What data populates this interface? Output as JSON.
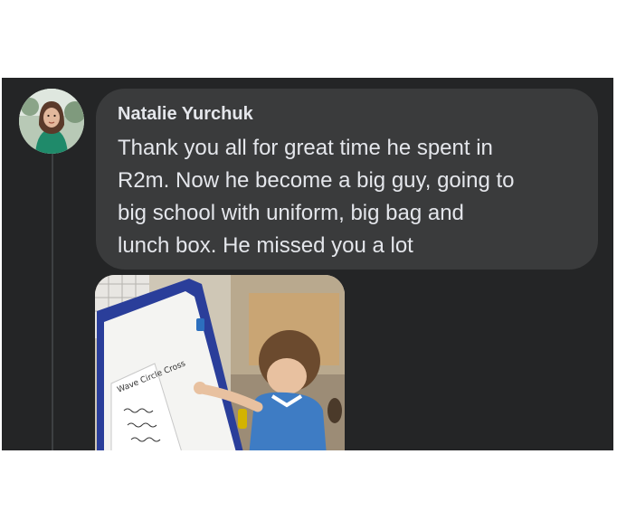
{
  "comment": {
    "author": "Natalie Yurchuk",
    "lines": [
      "Thank you all for great time he spent in",
      "R2m. Now he become a big guy, going to",
      "big school with uniform, big bag and",
      "lunch box. He missed you a lot"
    ]
  },
  "photo": {
    "worksheet_text": "Wave  Circle  Cross"
  },
  "colors": {
    "panel_bg": "#242526",
    "bubble_bg": "#3a3b3c",
    "text": "#e4e6eb"
  }
}
